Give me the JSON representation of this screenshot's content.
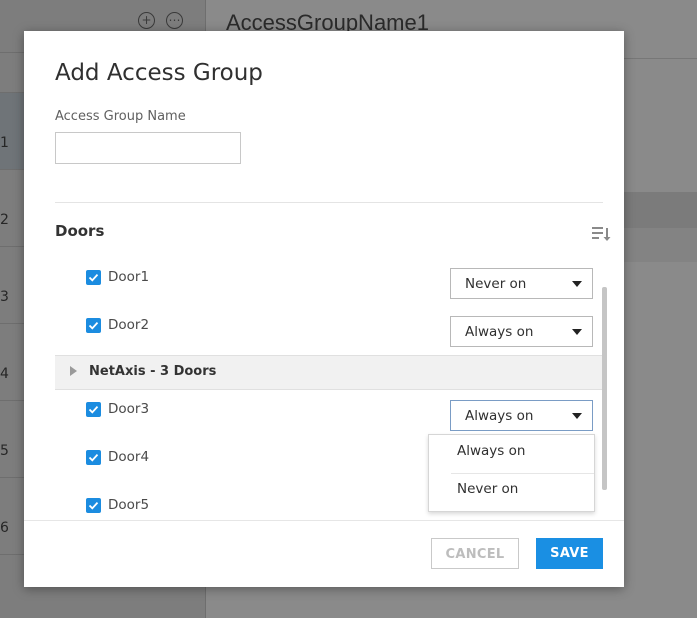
{
  "background": {
    "title": "AccessGroupName1",
    "row_numbers": [
      "1",
      "2",
      "3",
      "4",
      "5",
      "6"
    ],
    "header_icons": [
      "add-circle-icon",
      "more-circle-icon"
    ]
  },
  "modal": {
    "title": "Add Access Group",
    "name_field": {
      "label": "Access Group Name",
      "value": "",
      "placeholder": ""
    },
    "section_title": "Doors",
    "sort_icon": "sort-icon",
    "doors": [
      {
        "label": "Door1",
        "checked": true,
        "schedule": "Never on"
      },
      {
        "label": "Door2",
        "checked": true,
        "schedule": "Always on"
      }
    ],
    "group": {
      "label": "NetAxis - 3 Doors",
      "expanded": false
    },
    "group_doors": [
      {
        "label": "Door3",
        "checked": true,
        "schedule": "Always on"
      },
      {
        "label": "Door4",
        "checked": true
      },
      {
        "label": "Door5",
        "checked": true
      }
    ],
    "open_dropdown": {
      "options": [
        "Always on",
        "Never on"
      ]
    },
    "buttons": {
      "cancel": "CANCEL",
      "save": "SAVE"
    }
  },
  "colors": {
    "accent": "#1a8fe3",
    "checkbox": "#1b8ce0",
    "overlay": "#8a8a8a"
  }
}
